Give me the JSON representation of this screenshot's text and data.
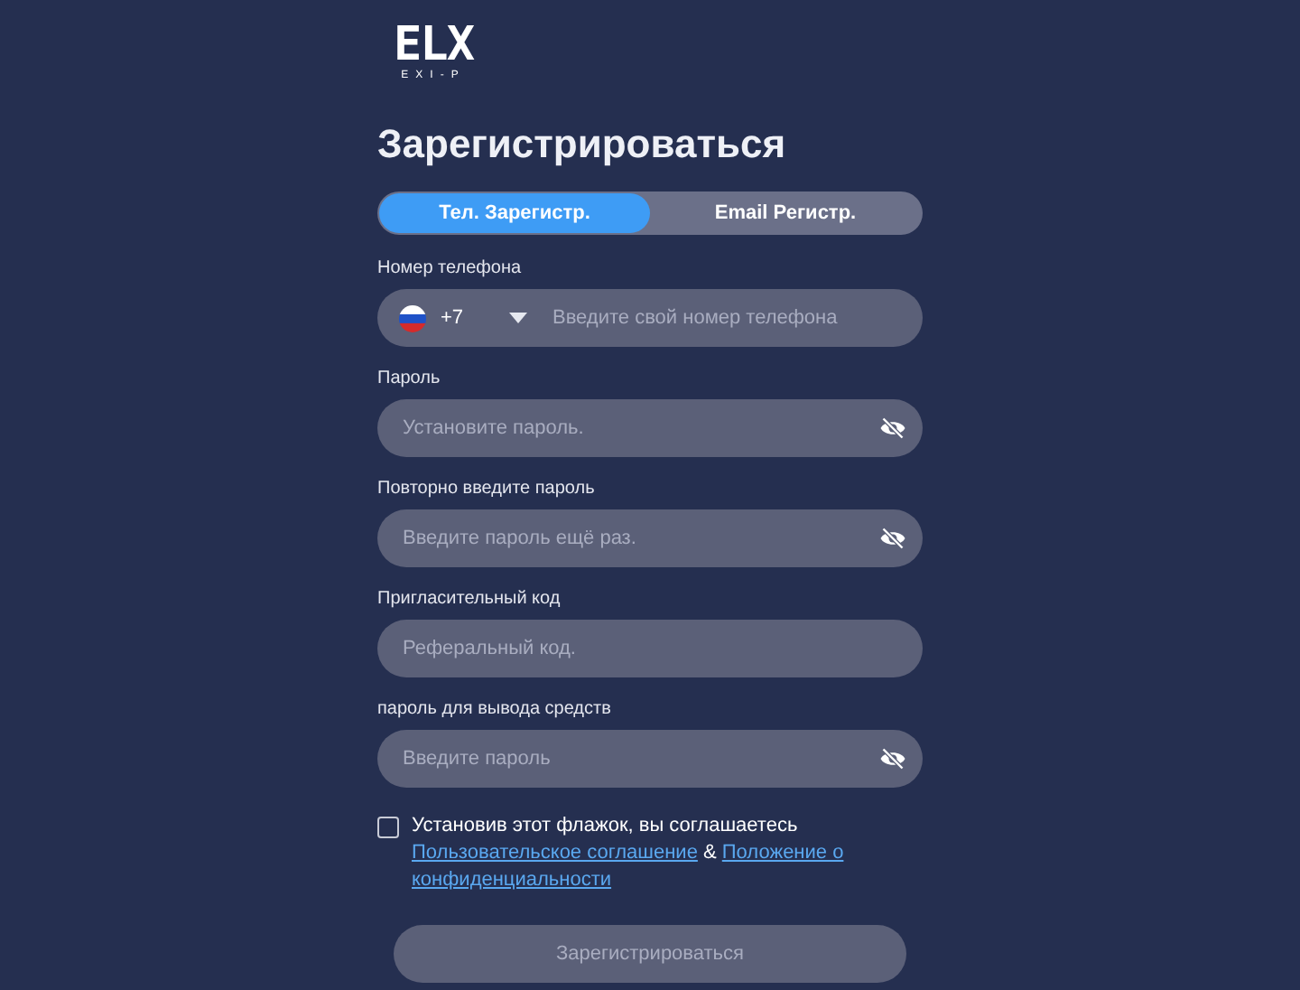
{
  "logo": {
    "mark": "ELX",
    "subtitle": "EXI-P"
  },
  "title": "Зарегистрироваться",
  "tabs": [
    {
      "label": "Тел. Зарегистр.",
      "selected": true
    },
    {
      "label": "Email Регистр.",
      "selected": false
    }
  ],
  "fields": [
    {
      "kind": "phone",
      "label": "Номер телефона",
      "code": "+7",
      "placeholder": "Введите свой номер телефона"
    },
    {
      "kind": "password",
      "label": "Пароль",
      "placeholder": "Установите пароль.",
      "visibility_toggle": true
    },
    {
      "kind": "password",
      "label": "Повторно введите пароль",
      "placeholder": "Введите пароль ещё раз.",
      "visibility_toggle": true
    },
    {
      "kind": "text",
      "label": "Пригласительный код",
      "placeholder": "Реферальный код."
    },
    {
      "kind": "password",
      "label": "пароль для вывода средств",
      "placeholder": "Введите пароль",
      "visibility_toggle": true
    }
  ],
  "agreement": {
    "checked": false,
    "text": "Установив этот флажок, вы соглашаетесь",
    "link_1": "Пользовательское соглашение",
    "joiner": "&",
    "link_2_lines": [
      "Положение о",
      "конфиденциальности"
    ]
  },
  "submit": {
    "label": "Зарегистрироваться",
    "disabled": true
  }
}
